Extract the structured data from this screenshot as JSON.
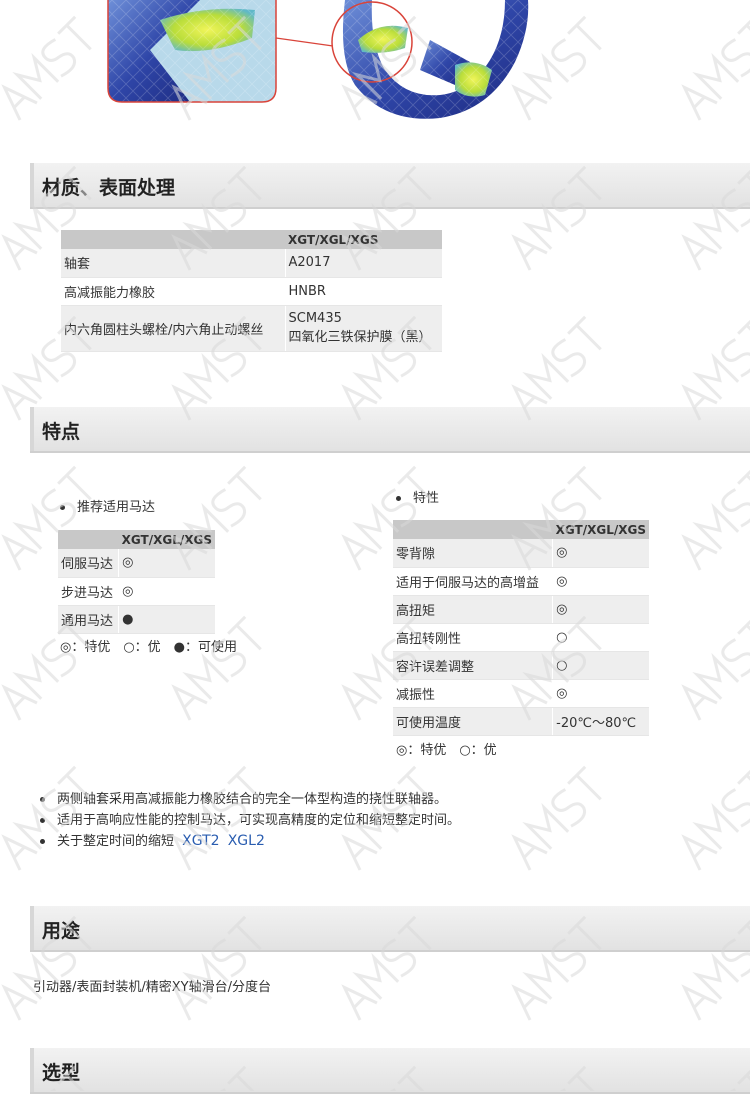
{
  "sections": {
    "materials": "材质、表面处理",
    "features": "特点",
    "applications": "用途",
    "selection": "选型"
  },
  "materials_table": {
    "header": [
      "",
      "XGT/XGL/XGS"
    ],
    "rows": [
      [
        "轴套",
        "A2017"
      ],
      [
        "高减振能力橡胶",
        "HNBR"
      ],
      [
        "内六角圆柱头螺栓/内六角止动螺丝",
        "SCM435",
        "四氧化三铁保护膜（黑）"
      ]
    ]
  },
  "motor_table": {
    "bullet": "推荐适用马达",
    "header": [
      "",
      "XGT/XGL/XGS"
    ],
    "rows": [
      [
        "伺服马达",
        "◎"
      ],
      [
        "步进马达",
        "◎"
      ],
      [
        "通用马达",
        "●"
      ]
    ],
    "legend": "◎：特优　○：优　●：可使用"
  },
  "property_table": {
    "bullet": "特性",
    "header": [
      "",
      "XGT/XGL/XGS"
    ],
    "rows": [
      [
        "零背隙",
        "◎"
      ],
      [
        "适用于伺服马达的高增益",
        "◎"
      ],
      [
        "高扭矩",
        "◎"
      ],
      [
        "高扭转刚性",
        "○"
      ],
      [
        "容许误差调整",
        "○"
      ],
      [
        "减振性",
        "◎"
      ],
      [
        "可使用温度",
        "-20℃～80℃"
      ]
    ],
    "legend": "◎：特优　○：优"
  },
  "feature_bullets": [
    "两侧轴套采用高减振能力橡胶结合的完全一体型构造的挠性联轴器。",
    "适用于高响应性能的控制马达，可实现高精度的定位和缩短整定时间。",
    "关于整定时间的缩短"
  ],
  "feature_links": [
    "XGT2",
    "XGL2"
  ],
  "applications_text": "引动器/表面封装机/精密XY轴滑台/分度台",
  "colors": {
    "header_bg": "#e6e6e6",
    "table_header": "#c8c8c8",
    "row_alt": "#eeeeee",
    "link": "#2a5db0",
    "fea_blue": "#2b3f9e",
    "fea_yellow": "#d7ea3a",
    "callout_red": "#d9443a"
  }
}
